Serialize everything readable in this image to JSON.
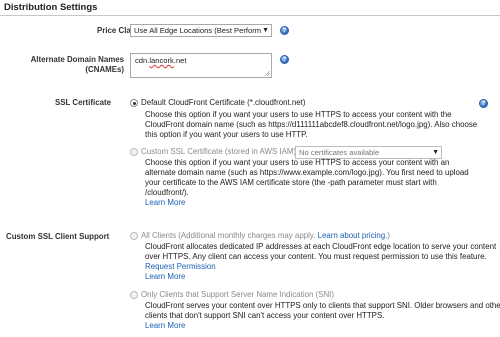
{
  "section": {
    "title": "Distribution Settings"
  },
  "price_class": {
    "label": "Price Class",
    "selected": "Use All Edge Locations (Best Perform"
  },
  "cnames": {
    "label_line1": "Alternate Domain Names",
    "label_line2": "(CNAMEs)",
    "value_a": "cdn.",
    "value_b": "lancork",
    "value_c": ".net"
  },
  "ssl_certificate": {
    "label": "SSL Certificate",
    "default_option": {
      "label": "Default CloudFront Certificate (*.cloudfront.net)",
      "desc": [
        "Choose this option if you want your users to use HTTPS to access your content with the",
        "CloudFront domain name (such as https://d111111abcdef8.cloudfront.net/logo.jpg). Also choose",
        "this option if you want your users to use HTTP."
      ]
    },
    "custom_option": {
      "label": "Custom SSL Certificate (stored in AWS IAM)",
      "select": "No certificates available",
      "desc": [
        "Choose this option if you want your users to use HTTPS to access your content with an",
        "alternate domain name (such as https://www.example.com/logo.jpg). You first need to upload",
        "your certificate to the AWS IAM certificate store (the -path parameter must start with",
        "/cloudfront/)."
      ],
      "learn_more": "Learn More"
    }
  },
  "client_support": {
    "label": "Custom SSL Client Support",
    "all_clients": {
      "label": "All Clients (Additional monthly charges may apply. ",
      "pricing_link": "Learn about pricing.",
      "label_end": ")",
      "desc": [
        "CloudFront allocates dedicated IP addresses at each CloudFront edge location to serve your content",
        "over HTTPS. Any client can access your content. You must request permission to use this feature."
      ],
      "request_permission": "Request Permission",
      "learn_more": "Learn More"
    },
    "sni_only": {
      "label": "Only Clients that Support Server Name Indication (SNI)",
      "desc": [
        "CloudFront serves your content over HTTPS only to clients that support SNI. Older browsers and other",
        "clients that don't support SNI can't access your content over HTTPS."
      ],
      "learn_more": "Learn More"
    }
  },
  "icons": {
    "help": "help-icon",
    "dropdown": "chevron-down-icon"
  }
}
